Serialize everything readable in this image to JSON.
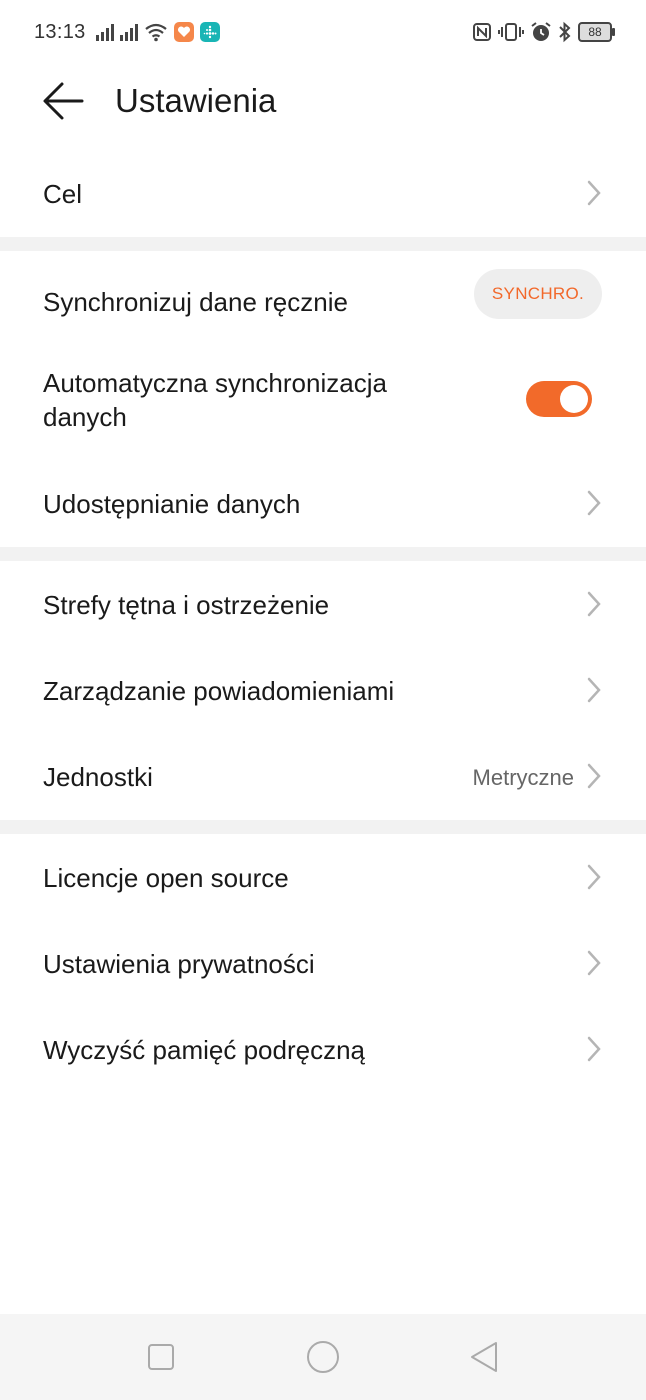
{
  "status_bar": {
    "time": "13:13",
    "battery": "88",
    "icons": [
      "signal-icon",
      "signal-icon",
      "wifi-icon",
      "health-app-icon",
      "fitbit-app-icon",
      "nfc-icon",
      "vibrate-icon",
      "alarm-icon",
      "bluetooth-icon",
      "battery-icon"
    ]
  },
  "header": {
    "title": "Ustawienia",
    "back_icon": "arrow-left-icon"
  },
  "sections": {
    "goal": {
      "label": "Cel"
    },
    "sync_manual": {
      "label": "Synchronizuj dane ręcznie",
      "button": "SYNCHRO."
    },
    "auto_sync": {
      "label_line1": "Automatyczna synchronizacja",
      "label_line2": "danych",
      "enabled": true
    },
    "data_sharing": {
      "label": "Udostępnianie danych"
    },
    "heart_zones": {
      "label": "Strefy tętna i ostrzeżenie"
    },
    "notifications": {
      "label": "Zarządzanie powiadomieniami"
    },
    "units": {
      "label": "Jednostki",
      "value": "Metryczne"
    },
    "licenses": {
      "label": "Licencje open source"
    },
    "privacy": {
      "label": "Ustawienia prywatności"
    },
    "clear_cache": {
      "label": "Wyczyść pamięć podręczną"
    }
  },
  "colors": {
    "accent": "#f26a2a",
    "separator": "#f2f2f2",
    "text": "#1a1a1a",
    "secondary_text": "#666666"
  },
  "nav_bar": {
    "icons": [
      "recents-square-icon",
      "home-circle-icon",
      "back-triangle-icon"
    ]
  }
}
